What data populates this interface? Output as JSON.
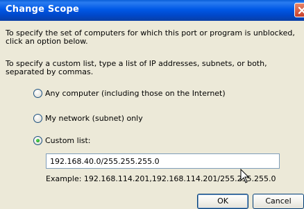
{
  "dialog": {
    "title": "Change Scope",
    "intro": "To specify the set of computers for which this port or program is unblocked, click an option below.",
    "custom_hint": "To specify a custom list, type a list of IP addresses, subnets, or both, separated by commas."
  },
  "options": [
    {
      "label": "Any computer (including those on the Internet)",
      "checked": false
    },
    {
      "label": "My network (subnet) only",
      "checked": false
    },
    {
      "label": "Custom list:",
      "checked": true
    }
  ],
  "custom_list": {
    "value": "192.168.40.0/255.255.255.0",
    "example": "Example: 192.168.114.201,192.168.114.201/255.255.255.0"
  },
  "buttons": {
    "ok": "OK",
    "cancel": "Cancel"
  },
  "colors": {
    "titlebar": "#0058e6",
    "dialog_bg": "#ece9d8",
    "radio_checked": "#21a121"
  }
}
